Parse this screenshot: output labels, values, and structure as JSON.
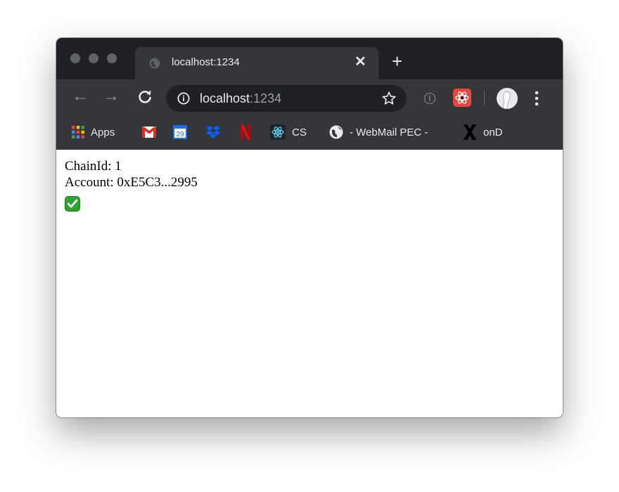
{
  "tab": {
    "title": "localhost:1234",
    "close": "✕"
  },
  "new_tab": "+",
  "omnibox": {
    "host": "localhost",
    "port": ":1234"
  },
  "bookmarks": [
    {
      "label": "Apps",
      "icon": "apps-grid-icon"
    },
    {
      "label": "",
      "icon": "gmail-icon"
    },
    {
      "label": "",
      "icon": "calendar-icon",
      "badge": "29"
    },
    {
      "label": "",
      "icon": "dropbox-icon"
    },
    {
      "label": "",
      "icon": "netflix-icon"
    },
    {
      "label": "CS",
      "icon": "react-icon"
    },
    {
      "label": "- WebMail PEC -",
      "icon": "globe-icon"
    },
    {
      "label": "onD",
      "icon": "x-logo-icon"
    }
  ],
  "page": {
    "chain_line": "ChainId: 1",
    "account_line": "Account: 0xE5C3...2995",
    "status_icon": "check-mark-icon"
  },
  "colors": {
    "titlebar": "#202124",
    "toolbar": "#35363a",
    "check": "#2ea32e"
  }
}
